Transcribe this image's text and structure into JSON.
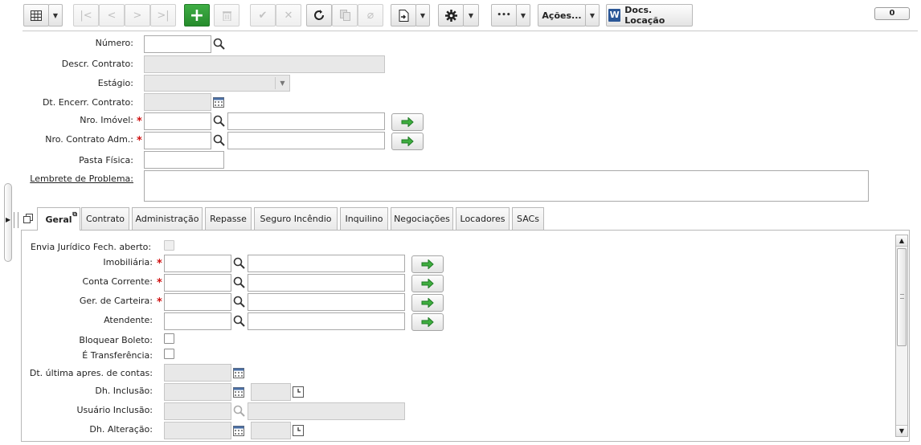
{
  "toolbar": {
    "acoes_label": "Ações...",
    "docs_label": "Docs. Locação",
    "more_label": "•••",
    "notif_count": "0",
    "word_letter": "W"
  },
  "form": {
    "numero_label": "Número:",
    "numero_value": "",
    "descr_label": "Descr. Contrato:",
    "estagio_label": "Estágio:",
    "dt_encerr_label": "Dt. Encerr. Contrato:",
    "nro_imovel_label": "Nro. Imóvel:",
    "nro_contrato_label": "Nro. Contrato Adm.:",
    "pasta_label": "Pasta Física:",
    "lembrete_label": "Lembrete de Problema:",
    "required_mark": "*"
  },
  "tabs": [
    "Geral",
    "Contrato",
    "Administração",
    "Repasse",
    "Seguro Incêndio",
    "Inquilino",
    "Negociações",
    "Locadores",
    "SACs"
  ],
  "geral": {
    "envia_label": "Envia Jurídico Fech. aberto:",
    "imobiliaria_label": "Imobiliária:",
    "conta_label": "Conta Corrente:",
    "ger_label": "Ger. de Carteira:",
    "atendente_label": "Atendente:",
    "bloquear_label": "Bloquear Boleto:",
    "transf_label": "É Transferência:",
    "dt_ultima_label": "Dt. última apres. de contas:",
    "dh_inclusao_label": "Dh. Inclusão:",
    "usuario_label": "Usuário Inclusão:",
    "dh_alteracao_label": "Dh. Alteração:"
  },
  "colors": {
    "accent_green": "#2e9a34",
    "required_red": "#d01010",
    "readonly_bg": "#e8e8e8"
  },
  "icons": [
    "grid-icon",
    "first-icon",
    "prev-icon",
    "next-icon",
    "last-icon",
    "add-icon",
    "trash-icon",
    "check-icon",
    "cancel-icon",
    "refresh-icon",
    "copy-icon",
    "attach-icon",
    "export-icon",
    "gear-icon",
    "search-icon",
    "calendar-icon",
    "clock-icon",
    "arrow-right-icon"
  ]
}
